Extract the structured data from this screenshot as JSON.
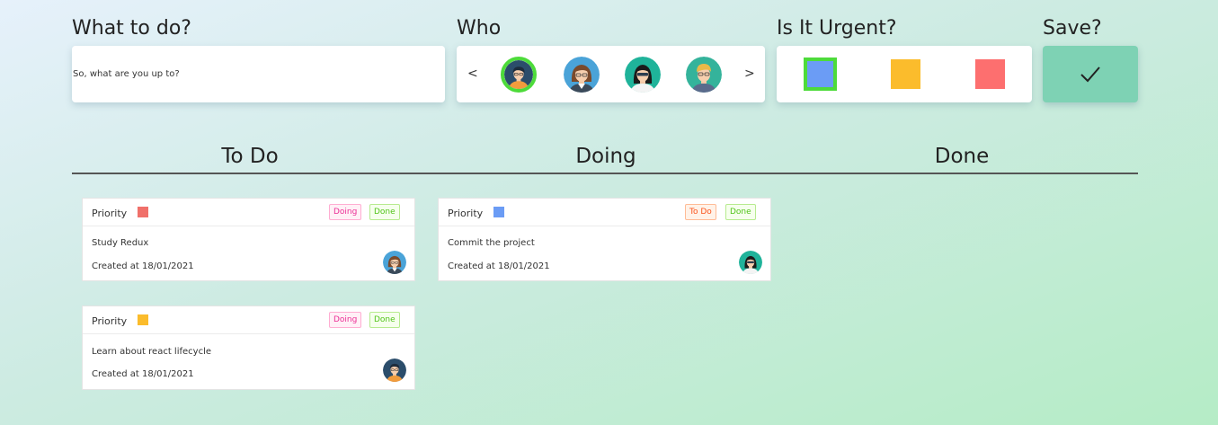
{
  "form": {
    "what_label": "What to do?",
    "task_placeholder": "So, what are you up to?",
    "who_label": "Who",
    "prev_arrow": "<",
    "next_arrow": ">",
    "assignees": [
      {
        "icon": "avatar-man-dark-hair-icon",
        "selected": true
      },
      {
        "icon": "avatar-woman-brown-hair-icon",
        "selected": false
      },
      {
        "icon": "avatar-woman-glasses-icon",
        "selected": false
      },
      {
        "icon": "avatar-man-blond-glasses-icon",
        "selected": false
      }
    ],
    "urgent_label": "Is It Urgent?",
    "urgency_colors": [
      "#6b9cf5",
      "#fbbc2c",
      "#fd6f6f"
    ],
    "selected_urgency": 0,
    "save_label": "Save?",
    "save_icon": "checkmark-icon",
    "colors": {
      "selected_border": "#4ddb3a",
      "save_bg": "#7ed2b4"
    }
  },
  "board": {
    "columns": [
      "To Do",
      "Doing",
      "Done"
    ],
    "priority_label": "Priority",
    "todo_cards": [
      {
        "priority_color": "#f0706a",
        "actions": [
          "Doing",
          "Done"
        ],
        "title": "Study Redux",
        "created": "Created at 18/01/2021",
        "avatar": "avatar-woman-brown-hair-icon"
      },
      {
        "priority_color": "#fbbc2c",
        "actions": [
          "Doing",
          "Done"
        ],
        "title": "Learn about react lifecycle",
        "created": "Created at 18/01/2021",
        "avatar": "avatar-man-dark-hair-icon"
      }
    ],
    "doing_cards": [
      {
        "priority_color": "#6b9cf5",
        "actions": [
          "To Do",
          "Done"
        ],
        "title": "Commit the project",
        "created": "Created at 18/01/2021",
        "avatar": "avatar-woman-glasses-icon"
      }
    ],
    "done_cards": []
  }
}
